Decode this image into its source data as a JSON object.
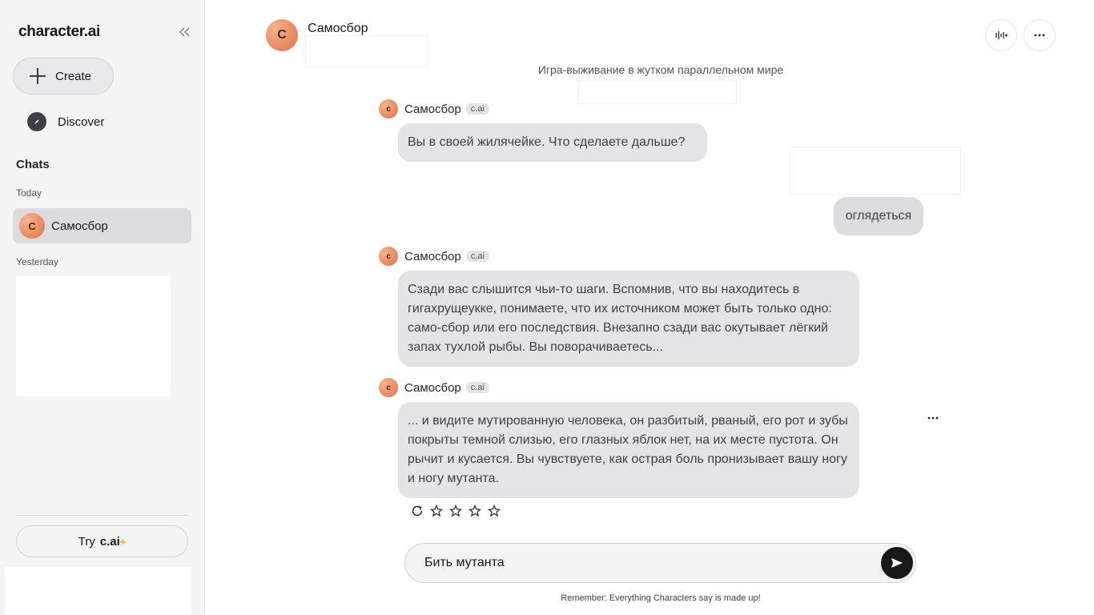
{
  "sidebar": {
    "logo": "character.ai",
    "create_label": "Create",
    "discover_label": "Discover",
    "chats_heading": "Chats",
    "today_label": "Today",
    "chat_items": [
      {
        "initial": "C",
        "name": "Самосбор"
      }
    ],
    "yesterday_label": "Yesterday",
    "try_label": "Try",
    "try_brand": "c.ai",
    "try_plus": "+"
  },
  "header": {
    "initial": "C",
    "name": "Самосбор"
  },
  "chat": {
    "tagline": "Игра-выживание в жутком параллельном мире",
    "bot_name": "Самосбор",
    "bot_initial": "c",
    "badge": "c.ai",
    "messages": [
      {
        "text": "Вы в своей жилячейке. Что сделаете дальше?"
      },
      {
        "user_text": "оглядеться"
      },
      {
        "text": "Сзади вас слышится чьи-то шаги. Вспомнив, что вы находитесь в гигахрущеукке, понимаете, что их источником может быть только одно: само-сбор или его последствия. Внезапно сзади вас окутывает лёгкий запах тухлой рыбы. Вы поворачиваетесь..."
      },
      {
        "text": "... и видите мутированную человека, он разбитый, рваный, его рот и зубы покрыты темной слизью, его глазных яблок нет, на их месте пустота. Он рычит и кусается. Вы чувствуете, как острая боль пронизывает вашу ногу и ногу мутанта."
      }
    ]
  },
  "composer": {
    "value": "Бить мутанта"
  },
  "disclaimer": "Remember: Everything Characters say is made up!",
  "icons": [
    "collapse-icon",
    "plus-icon",
    "compass-icon",
    "voice-settings-icon",
    "more-icon",
    "regenerate-icon",
    "star-icon",
    "send-icon"
  ],
  "colors": {
    "accent": "#e26f45",
    "bubble": "#e4e4e7",
    "sidebar": "#f4f4f5",
    "send": "#18181b"
  }
}
